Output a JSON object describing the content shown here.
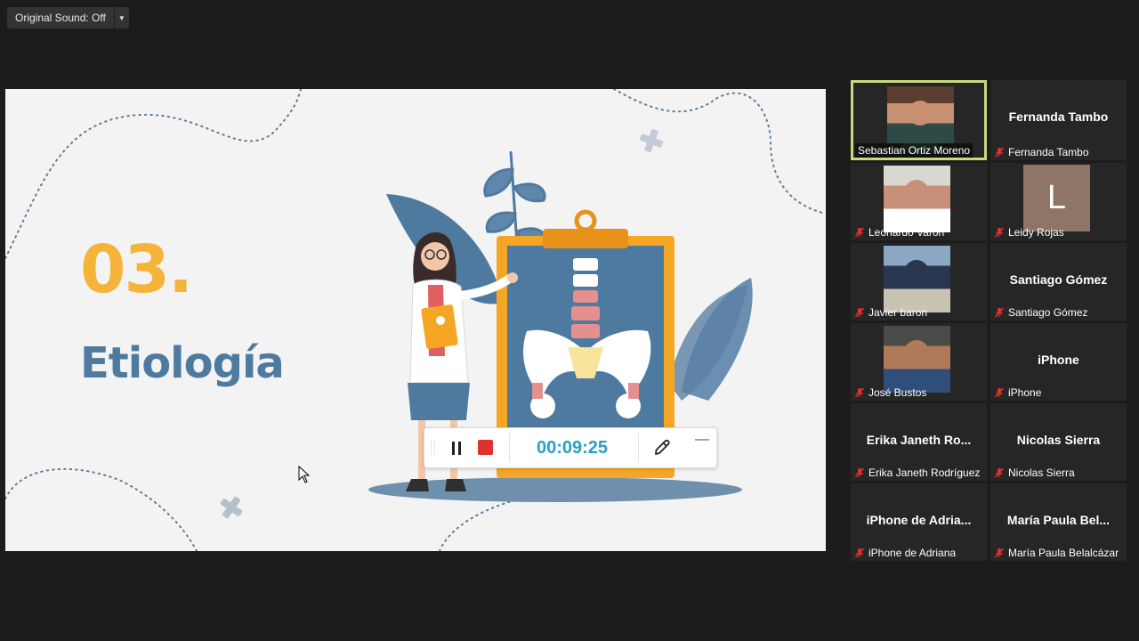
{
  "toolbar": {
    "original_sound_label": "Original Sound: Off"
  },
  "slide": {
    "number": "03.",
    "title": "Etiología"
  },
  "recording": {
    "timer": "00:09:25"
  },
  "participants": [
    {
      "caption": "Sebastian Ortiz Moreno",
      "display": "",
      "type": "video",
      "muted": false,
      "active": true
    },
    {
      "caption": "Fernanda Tambo",
      "display": "Fernanda Tambo",
      "type": "name",
      "muted": true,
      "active": false
    },
    {
      "caption": "Leonardo Varon",
      "display": "",
      "type": "video",
      "muted": true,
      "active": false
    },
    {
      "caption": "Leidy Rojas",
      "display": "L",
      "type": "letter",
      "muted": true,
      "active": false
    },
    {
      "caption": "Javier baron",
      "display": "",
      "type": "video",
      "muted": true,
      "active": false
    },
    {
      "caption": "Santiago Gómez",
      "display": "Santiago Gómez",
      "type": "name",
      "muted": true,
      "active": false
    },
    {
      "caption": "José Bustos",
      "display": "",
      "type": "video",
      "muted": true,
      "active": false
    },
    {
      "caption": "iPhone",
      "display": "iPhone",
      "type": "name",
      "muted": true,
      "active": false
    },
    {
      "caption": "Erika Janeth Rodríguez",
      "display": "Erika Janeth Ro...",
      "type": "name",
      "muted": true,
      "active": false
    },
    {
      "caption": "Nicolas Sierra",
      "display": "Nicolas Sierra",
      "type": "name",
      "muted": true,
      "active": false
    },
    {
      "caption": "iPhone de Adriana",
      "display": "iPhone de Adria...",
      "type": "name",
      "muted": true,
      "active": false
    },
    {
      "caption": "María Paula Belalcázar",
      "display": "María Paula Bel...",
      "type": "name",
      "muted": true,
      "active": false
    }
  ],
  "colors": {
    "accent_number": "#f6b33a",
    "accent_title": "#4f7aa0",
    "timer": "#2b9fc4",
    "stop": "#e03131",
    "active_border": "#c6dc7a",
    "muted_icon": "#e03131"
  }
}
